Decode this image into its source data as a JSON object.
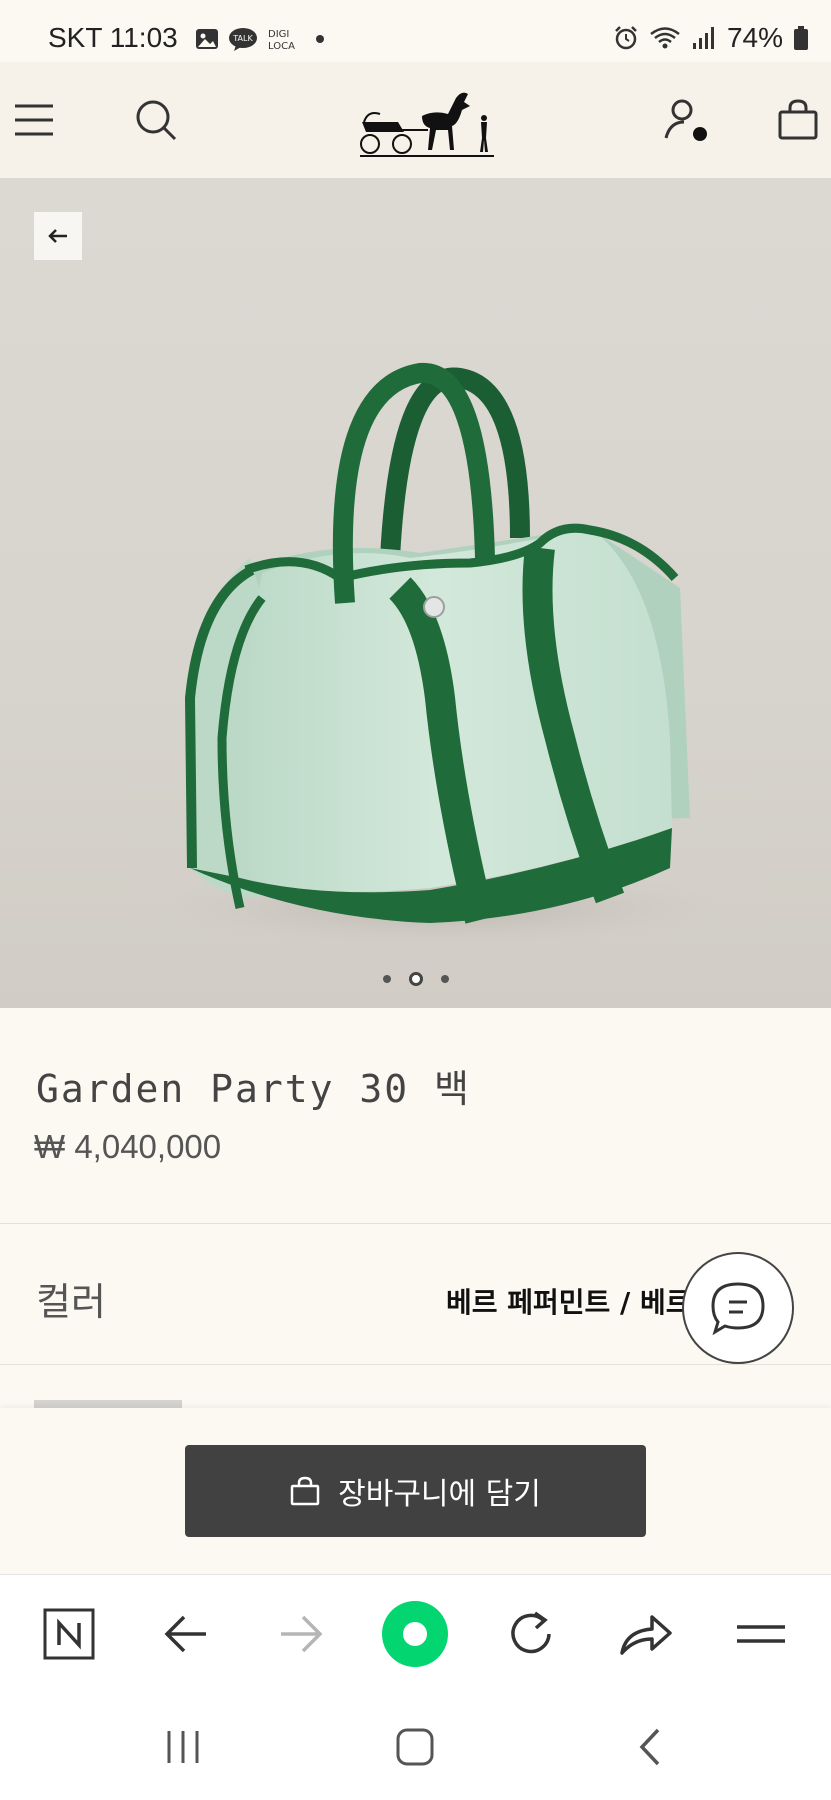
{
  "status_bar": {
    "carrier_time": "SKT 11:03",
    "app_icon_talk": "TALK",
    "app_icon_digi_line1": "DIGI",
    "app_icon_digi_line2": "LOCA",
    "battery": "74%"
  },
  "nav": {
    "brand": "Hermès carriage logo"
  },
  "product": {
    "title": "Garden Party 30 백",
    "price": "₩ 4,040,000",
    "color_label": "컬러",
    "color_value": "베르 페퍼민트 / 베르 ...",
    "image_pages": 3,
    "active_page": 2
  },
  "actions": {
    "add_to_cart": "장바구니에 담기"
  },
  "colors": {
    "bag_canvas": "#cfe6d8",
    "bag_leather": "#1f6b3a",
    "button_dark": "#414141",
    "browser_accent": "#00d66b"
  }
}
